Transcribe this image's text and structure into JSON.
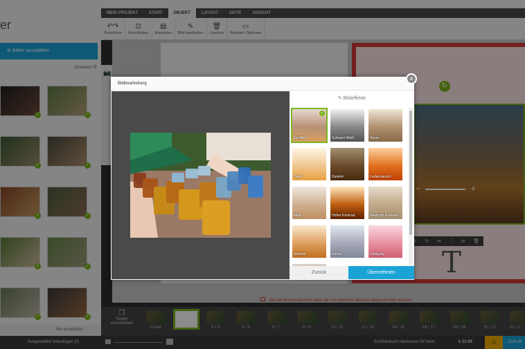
{
  "app": {
    "title": "er"
  },
  "menu": {
    "tabs": [
      "MEIN PROJEKT",
      "START",
      "OBJEKT",
      "LAYOUT",
      "SEITE",
      "ANSICHT"
    ],
    "active": "OBJEKT"
  },
  "toolbar": {
    "items": [
      {
        "label": "Zurück/vor",
        "icon": "undo-redo-icon"
      },
      {
        "label": "Koordinaten",
        "icon": "coordinates-icon"
      },
      {
        "label": "Einsetzen",
        "icon": "insert-icon"
      },
      {
        "label": "Bild bearbeiten",
        "icon": "edit-image-icon"
      },
      {
        "label": "Löschen",
        "icon": "trash-icon"
      },
      {
        "label": "Rahmen Optionen",
        "icon": "frame-options-icon"
      }
    ]
  },
  "sidebar": {
    "select_images": "Bilder auswählen",
    "sort_label": "Unsortiert",
    "all_select": "Alle auswählen",
    "add_selected": "Ausgewählte hinzufügen (0)"
  },
  "canvas": {
    "big_letter": "T",
    "warning": "Bei der Buchproduktion kann der rot markierte Bereich abgeschnitten werden."
  },
  "filmstrip": {
    "move_pages": "Seiten verschieben",
    "pages": [
      "Cover",
      "1",
      "2 / 3",
      "4 / 5",
      "6 / 7",
      "8 / 9",
      "10 / 11",
      "12 / 13",
      "14 / 15",
      "16 / 17",
      "18 / 19",
      "20 / 21",
      "22 / 2"
    ]
  },
  "statusbar": {
    "product": "Echtfotobuch Hardcover A4 hoch",
    "price": "€ 22.99",
    "cart": "Zum W"
  },
  "modal": {
    "title": "Bildbearbeitung",
    "effects_header": "Bildeffekte",
    "back": "Zurück",
    "apply": "Übernehmen",
    "effects": [
      {
        "label": "Ein Bild",
        "selected": true
      },
      {
        "label": "Schwarz-Weiß",
        "selected": false
      },
      {
        "label": "Sepia",
        "selected": false
      },
      {
        "label": "Heller",
        "selected": false
      },
      {
        "label": "Dunkler",
        "selected": false
      },
      {
        "label": "Farbenrausch",
        "selected": false
      },
      {
        "label": "Milde",
        "selected": false
      },
      {
        "label": "Hoher Kontrast",
        "selected": false
      },
      {
        "label": "Niedriger Kontrast",
        "selected": false
      },
      {
        "label": "Wärmer",
        "selected": false
      },
      {
        "label": "Kühler",
        "selected": false
      },
      {
        "label": "Sättigung",
        "selected": false
      }
    ]
  },
  "colors": {
    "accent_blue": "#1ba3d6",
    "accent_green": "#7ab51d",
    "warning_red": "#d63a3a"
  }
}
